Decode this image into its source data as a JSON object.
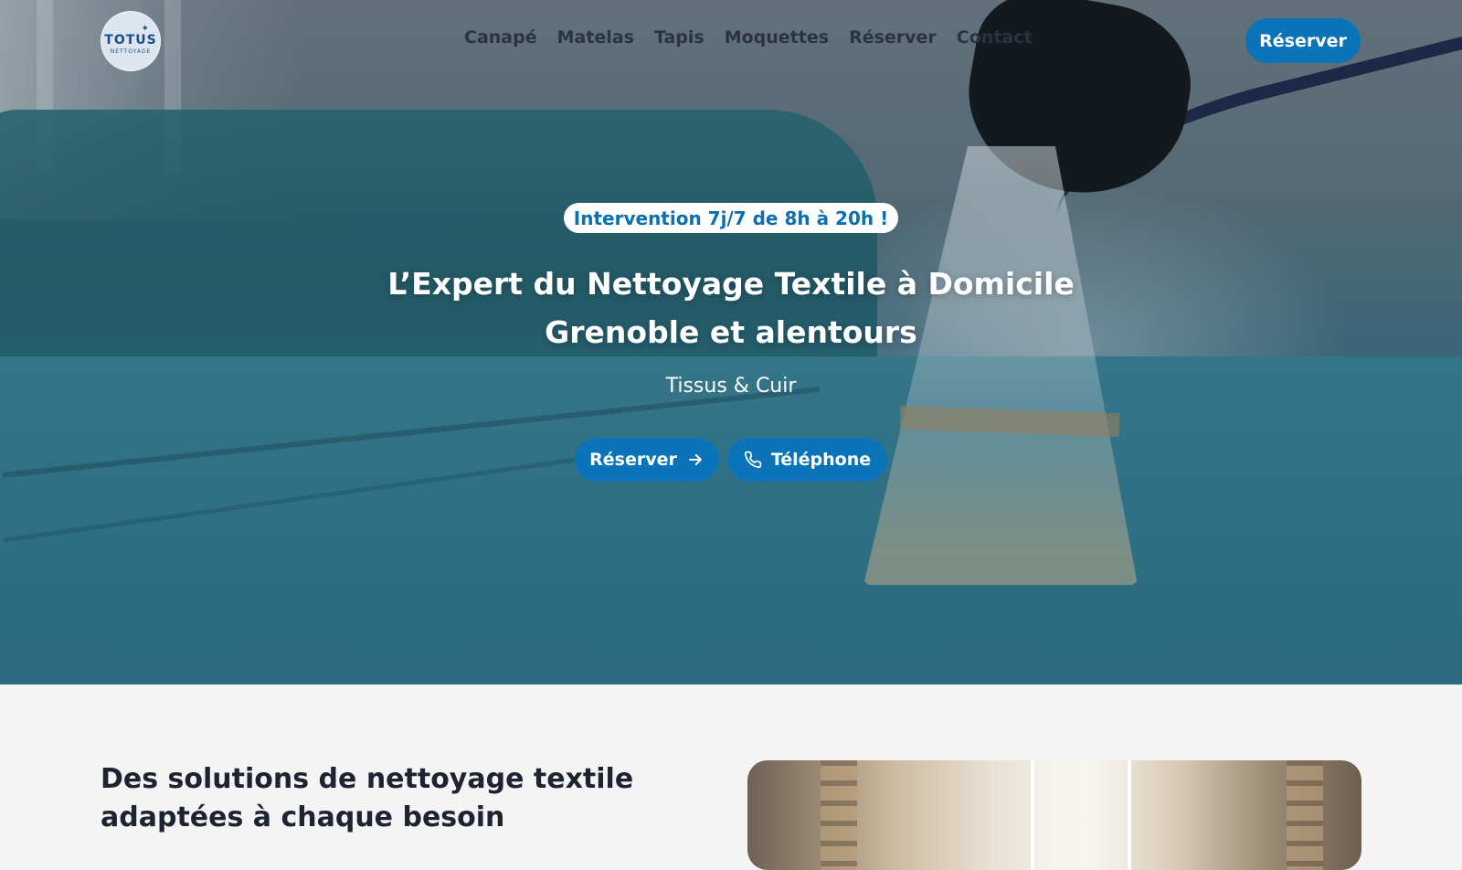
{
  "brand": {
    "logo_main": "TOTUS",
    "logo_sub": "NETTOYAGE"
  },
  "nav": {
    "items": [
      {
        "label": "Canapé"
      },
      {
        "label": "Matelas"
      },
      {
        "label": "Tapis"
      },
      {
        "label": "Moquettes"
      },
      {
        "label": "Réserver"
      },
      {
        "label": "Contact"
      }
    ],
    "cta_label": "Réserver"
  },
  "hero": {
    "badge": "Intervention 7j/7 de 8h à 20h !",
    "title_line1": "L’Expert du Nettoyage Textile à Domicile",
    "title_line2": "Grenoble et alentours",
    "subtitle": "Tissus & Cuir",
    "reserve_label": "Réserver",
    "phone_label": "Téléphone"
  },
  "section": {
    "title": "Des solutions de nettoyage textile adaptées à chaque besoin"
  },
  "colors": {
    "accent": "#0b73b7",
    "badge_text": "#0b6fb0",
    "section_bg": "#f4f4f4"
  },
  "icons": {
    "arrow": "arrow-right-icon",
    "phone": "phone-icon",
    "star": "sparkle-icon"
  }
}
